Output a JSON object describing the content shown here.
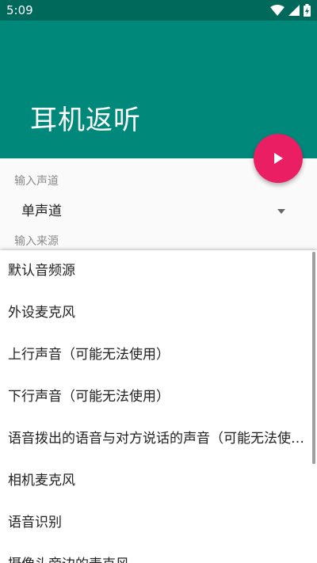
{
  "status_bar": {
    "time": "5:09",
    "icons": [
      "wifi-icon",
      "signal-icon",
      "battery-icon"
    ]
  },
  "app_bar": {
    "title": "耳机返听",
    "color": "#00897b"
  },
  "fab": {
    "icon": "play-icon",
    "color": "#e91e63"
  },
  "form": {
    "channel_label": "输入声道",
    "channel_value": "单声道",
    "source_label": "输入来源"
  },
  "dropdown": {
    "items": [
      "默认音频源",
      "外设麦克风",
      "上行声音（可能无法使用）",
      "下行声音（可能无法使用）",
      "语音拨出的语音与对方说话的声音（可能无法使用）",
      "相机麦克风",
      "语音识别",
      "摄像头旁边的麦克风"
    ]
  }
}
